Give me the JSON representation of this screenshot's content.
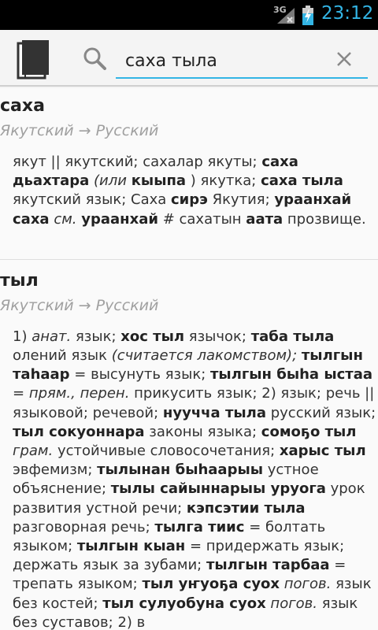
{
  "status_bar": {
    "network": "3G",
    "time": "23:12"
  },
  "search": {
    "query": "саха тыла"
  },
  "colors": {
    "accent": "#33b5e5",
    "status_background": "#000000"
  },
  "icons": {
    "app": "book-icon",
    "search": "search-icon",
    "clear": "close-icon"
  },
  "entries": [
    {
      "headword": "саха",
      "direction": "Якутский → Русский",
      "definition_html": "якут || якутский; сахалар якуты; <b>саха дьахтара</b> <i>(или</i> <b>кыыпа</b> ) якутка; <b>саха тыла</b> якутский язык; Саха <b>сирэ</b> Якутия; <b>ураанхай саха</b> <i>см.</i> <b>ураанхай</b> # сахатын <b>аата</b> прозвище."
    },
    {
      "headword": "тыл",
      "direction": "Якутский → Русский",
      "definition_html": "1) <i>анат.</i> язык; <b>хос тыл</b> язычок; <b>таба тыла</b> олений язык <i>(считается лакомством);</i> <b>тылгын таhаар</b> = высунуть язык; <b>тылгын быhа ыстаа</b> = <i>прям., перен.</i> прикусить язык; 2) язык; речь || языковой; речевой; <b>нууччa тыла</b> русский язык; <b>тыл сокуоннара</b> законы языка; <b>сомоҕо тыл</b> <i>грам.</i> устойчивые словосочетания; <b>харыс тыл</b> эвфемизм; <b>тылынан быhаарыы</b> устное объяснение; <b>тылы сайыннарыы уруога</b> урок развития устной речи; <b>кэпсэтии тыла</b> разговорная речь; <b>тылга тиис</b> = болтать языком; <b>тылгын кыан</b> = придержать язык; держать язык за зубами; <b>тылгын тарбаа</b> = трепать языком; <b>тыл уҥуоҕа суох</b> <i>погов.</i> язык без костей; <b>тыл сулуобуна суох</b> <i>погов.</i> язык без суставов; 2) в"
    }
  ]
}
